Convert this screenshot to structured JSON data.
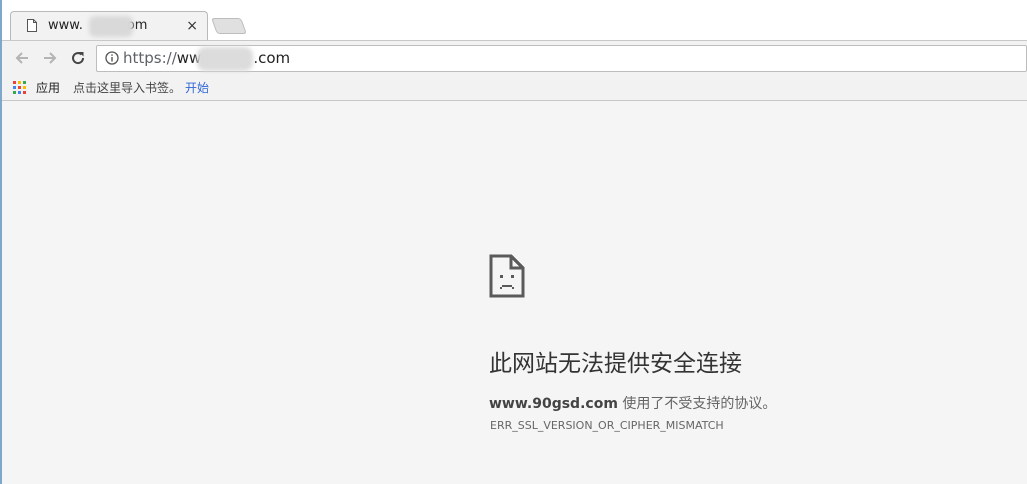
{
  "tab": {
    "title_prefix": "www.",
    "title_suffix": "om",
    "close_symbol": "×"
  },
  "toolbar": {
    "back_icon": "arrow-left-icon",
    "forward_icon": "arrow-right-icon",
    "reload_icon": "reload-icon",
    "url_scheme": "https://",
    "url_host_prefix": "ww",
    "url_host_suffix": ".com"
  },
  "bookmarks": {
    "apps_label": "应用",
    "hint": "点击这里导入书签。",
    "start_link": "开始"
  },
  "error": {
    "title": "此网站无法提供安全连接",
    "domain": "www.90gsd.com",
    "message": " 使用了不受支持的协议。",
    "code": "ERR_SSL_VERSION_OR_CIPHER_MISMATCH"
  },
  "colors": {
    "link": "#3367d6",
    "page_bg": "#f5f5f5",
    "tab_bg": "#f2f2f2"
  }
}
